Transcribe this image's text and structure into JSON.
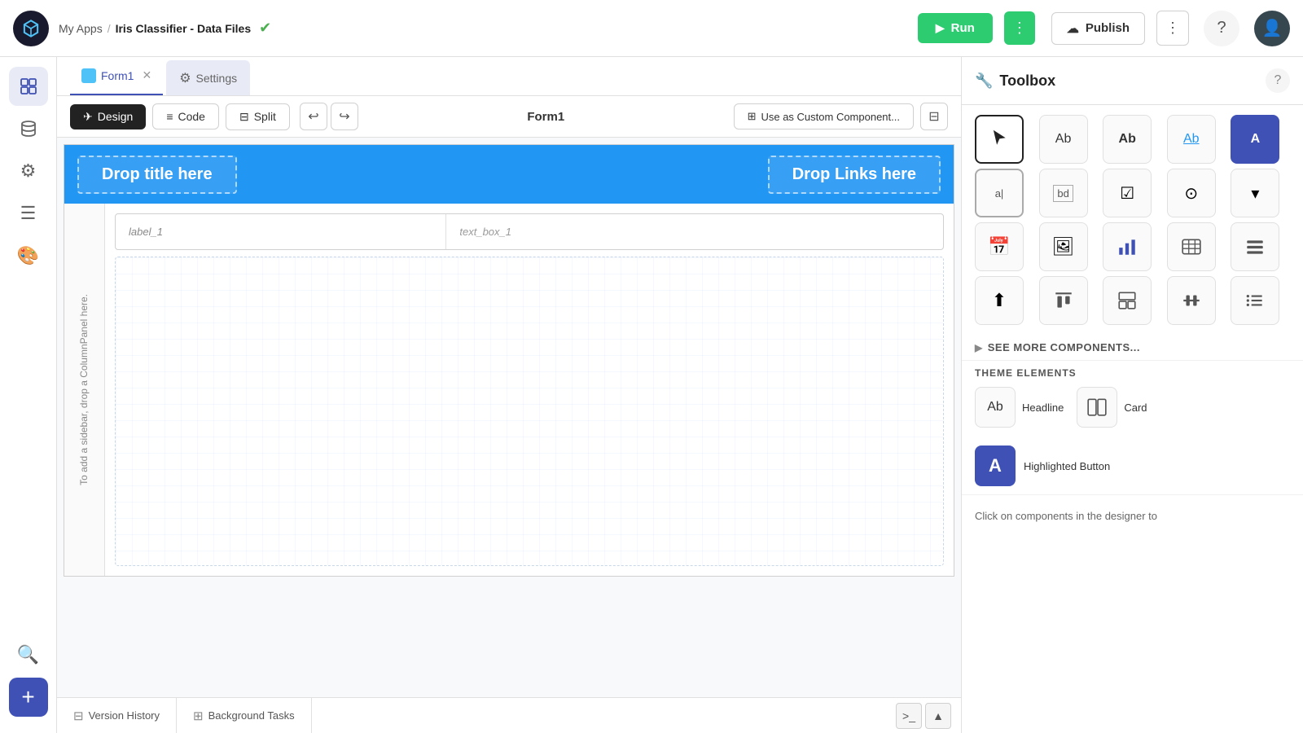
{
  "topbar": {
    "app_name": "My Apps",
    "separator": "/",
    "project_name": "Iris Classifier - Data Files",
    "run_label": "Run",
    "publish_label": "Publish",
    "more_icon": "⋮"
  },
  "tabs": {
    "form1": {
      "label": "Form1"
    },
    "settings": {
      "label": "Settings"
    }
  },
  "toolbar": {
    "design_label": "Design",
    "code_label": "Code",
    "split_label": "Split",
    "form_title": "Form1",
    "custom_component_label": "Use as Custom Component..."
  },
  "nav_bar": {
    "drop_title": "Drop title here",
    "drop_links": "Drop Links here"
  },
  "sidebar_panel": {
    "text": "To add a sidebar, drop a ColumnPanel here."
  },
  "form_fields": [
    {
      "label": "label_1",
      "input": "text_box_1"
    }
  ],
  "toolbox": {
    "title": "Toolbox",
    "tools": [
      {
        "id": "cursor",
        "symbol": "↖",
        "label": "Cursor"
      },
      {
        "id": "text-label",
        "symbol": "Ab",
        "label": "Label"
      },
      {
        "id": "text-bold",
        "symbol": "Ab",
        "label": "TextBold"
      },
      {
        "id": "text-link",
        "symbol": "Ab",
        "label": "TextLink",
        "underline": true
      },
      {
        "id": "text-button",
        "symbol": "A",
        "label": "Button",
        "button": true
      },
      {
        "id": "text-input-small",
        "symbol": "a|",
        "label": "InputSmall"
      },
      {
        "id": "text-input-bd",
        "symbol": "bd",
        "label": "InputBd"
      },
      {
        "id": "checkbox",
        "symbol": "☑",
        "label": "Checkbox"
      },
      {
        "id": "radio",
        "symbol": "⊙",
        "label": "Radio"
      },
      {
        "id": "dropdown",
        "symbol": "▾",
        "label": "Dropdown"
      },
      {
        "id": "calendar",
        "symbol": "📅",
        "label": "Calendar"
      },
      {
        "id": "image",
        "symbol": "🖼",
        "label": "Image"
      },
      {
        "id": "bar-chart",
        "symbol": "📊",
        "label": "BarChart"
      },
      {
        "id": "table",
        "symbol": "⊞",
        "label": "Table"
      },
      {
        "id": "form",
        "symbol": "≡",
        "label": "Form"
      },
      {
        "id": "upload",
        "symbol": "⬆",
        "label": "Upload"
      },
      {
        "id": "align-top",
        "symbol": "⊤",
        "label": "AlignTop"
      },
      {
        "id": "layout",
        "symbol": "⊟",
        "label": "Layout"
      },
      {
        "id": "spacer-h",
        "symbol": "―",
        "label": "SpacerH"
      },
      {
        "id": "list",
        "symbol": "≡",
        "label": "List"
      }
    ],
    "see_more": "SEE MORE COMPONENTS...",
    "theme_section_title": "THEME ELEMENTS",
    "theme_items": [
      {
        "id": "headline",
        "symbol": "Ab",
        "label": "Headline"
      },
      {
        "id": "card",
        "symbol": "⊞",
        "label": "Card"
      }
    ],
    "highlighted_button_label": "Highlighted Button",
    "click_hint": "Click on components in the designer to"
  },
  "bottom_bar": {
    "version_history": "Version History",
    "background_tasks": "Background Tasks"
  }
}
